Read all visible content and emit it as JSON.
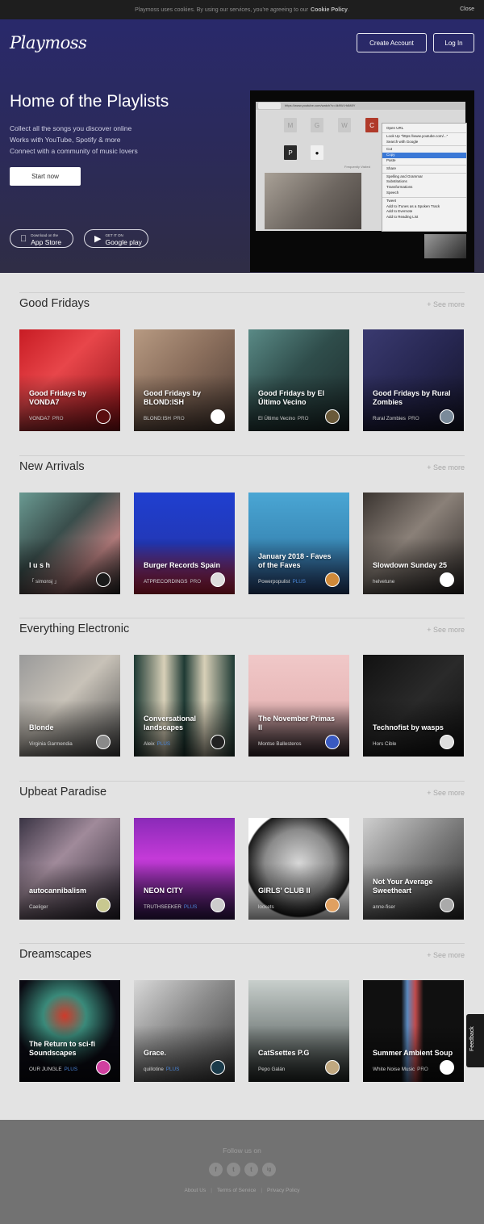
{
  "cookie": {
    "text": "Playmoss uses cookies. By using our services, you're agreeing to our",
    "link": "Cookie Policy",
    "end": ".",
    "close": "Close"
  },
  "header": {
    "logo": "Playmoss",
    "create_account": "Create Account",
    "login": "Log In"
  },
  "hero": {
    "title": "Home of the Playlists",
    "lines": [
      "Collect all the songs you discover online",
      "Works with YouTube, Spotify & more",
      "Connect with a community of music lovers"
    ],
    "start": "Start now",
    "app_store": {
      "small": "Download on the",
      "big": "App Store"
    },
    "google_play": {
      "small": "GET IT ON",
      "big": "Google play"
    }
  },
  "demo": {
    "url": "https://www.youtube.com/watch?v=4k9W-HdM8Y",
    "tiles": [
      "M",
      "G",
      "W",
      "C",
      "P",
      "P"
    ],
    "bottom_label": "Frequently Visited",
    "menu": [
      "Open URL",
      "",
      "Look Up \"https://www.youtube.com/...\"",
      "Search with Google",
      "",
      "Cut",
      "Copy",
      "Paste",
      "",
      "Share",
      "",
      "Spelling and Grammar",
      "Substitutions",
      "Transformations",
      "Speech",
      "",
      "Tweet",
      "Add to iTunes as a Spoken Track",
      "Add to Evernote",
      "Add to Reading List"
    ],
    "highlighted": "Copy"
  },
  "sections": [
    {
      "title": "Good Fridays",
      "see_more": "+ See more",
      "cards": [
        {
          "title": "Good Fridays by VONDA7",
          "owner": "VONDA7",
          "badge": "PRO",
          "badge_type": "pro",
          "bg": "linear-gradient(135deg,#c81c24 0%,#e8464a 40%,#8e1016 100%)",
          "avatar": "#5a0e10"
        },
        {
          "title": "Good Fridays by BLOND:ISH",
          "owner": "BLOND:ISH",
          "badge": "PRO",
          "badge_type": "pro",
          "bg": "linear-gradient(135deg,#b79a82 0%,#8a6e5c 45%,#4c3b33 100%)",
          "avatar": "#ffffff"
        },
        {
          "title": "Good Fridays by El Último Vecino",
          "owner": "El Último Vecino",
          "badge": "PRO",
          "badge_type": "pro",
          "bg": "linear-gradient(135deg,#5a8a86 0%,#2f4d4b 45%,#1c2b2b 100%)",
          "avatar": "#6a5a3a"
        },
        {
          "title": "Good Fridays by Rural Zombies",
          "owner": "Rural Zombies",
          "badge": "PRO",
          "badge_type": "pro",
          "bg": "linear-gradient(135deg,#3a3a70 0%,#262650 50%,#141428 100%)",
          "avatar": "#7a8a9a"
        }
      ]
    },
    {
      "title": "New Arrivals",
      "see_more": "+ See more",
      "cards": [
        {
          "title": "l u s h",
          "owner": "「 simonsj 」",
          "badge": "",
          "badge_type": "",
          "bg": "linear-gradient(135deg,#6a9a92 0%,#3a4e4c 40%,#b07a7a 70%,#2a2a2a 100%)",
          "avatar": "#1a1a1a"
        },
        {
          "title": "Burger Records Spain",
          "owner": "ATPRECORDINGS",
          "badge": "PRO",
          "badge_type": "pro",
          "bg": "linear-gradient(180deg,#1f3fd0 0%,#2238b8 50%,#d0203a 100%)",
          "avatar": "#dddddd"
        },
        {
          "title": "January 2018 - Faves of the Faves",
          "owner": "Powerpopulist",
          "badge": "PLUS",
          "badge_type": "plus",
          "bg": "linear-gradient(180deg,#4aa6d4 0%,#3a8ab8 50%,#2a4a80 100%)",
          "avatar": "#d08a3a"
        },
        {
          "title": "Slowdown Sunday 25",
          "owner": "helvetune",
          "badge": "",
          "badge_type": "",
          "bg": "linear-gradient(135deg,#3a3430 0%,#8a8078 45%,#2a2624 100%)",
          "avatar": "#ffffff"
        }
      ]
    },
    {
      "title": "Everything Electronic",
      "see_more": "+ See more",
      "cards": [
        {
          "title": "Blonde",
          "owner": "Virginia Garmendia",
          "badge": "",
          "badge_type": "",
          "bg": "linear-gradient(135deg,#9a9a9a 0%,#c8c2b8 45%,#4a4a4a 100%)",
          "avatar": "#8a8a8a"
        },
        {
          "title": "Conversational landscapes",
          "owner": "Aleix",
          "badge": "PLUS",
          "badge_type": "plus",
          "bg": "linear-gradient(90deg,#1e3a34 0%,#d8d0b8 30%,#1e3a34 50%,#d8d0b8 70%,#1e3a34 100%)",
          "avatar": "#222222"
        },
        {
          "title": "The November Primas II",
          "owner": "Montse Ballesteros",
          "badge": "",
          "badge_type": "",
          "bg": "linear-gradient(180deg,#f0c8c8 0%,#e8b8b8 50%,#3a2a30 100%)",
          "avatar": "#3a5ac0"
        },
        {
          "title": "Technofist by wasps",
          "owner": "Hors Cible",
          "badge": "",
          "badge_type": "",
          "bg": "linear-gradient(135deg,#111111 0%,#2a2a2a 50%,#101010 100%)",
          "avatar": "#dddddd"
        }
      ]
    },
    {
      "title": "Upbeat Paradise",
      "see_more": "+ See more",
      "cards": [
        {
          "title": "autocannibalism",
          "owner": "Caeliger",
          "badge": "",
          "badge_type": "",
          "bg": "linear-gradient(135deg,#3a3444 0%,#a08a9a 40%,#2a2430 100%)",
          "avatar": "#c8c890"
        },
        {
          "title": "NEON CITY",
          "owner": "TRUTHSEEKER",
          "badge": "PLUS",
          "badge_type": "plus",
          "bg": "linear-gradient(180deg,#8a2ab8 0%,#c43ad8 40%,#3a1a5a 100%)",
          "avatar": "#cccccc"
        },
        {
          "title": "GIRLS' CLUB II",
          "owner": "lockets",
          "badge": "",
          "badge_type": "",
          "bg": "radial-gradient(circle at 50% 45%,#d8d8d8 0%,#8a8a8a 45%,#1a1a1a 70%,#ffffff 72%)",
          "avatar": "#e0a060"
        },
        {
          "title": "Not Your Average Sweetheart",
          "owner": "anne-fiser",
          "badge": "",
          "badge_type": "",
          "bg": "linear-gradient(135deg,#cfcfcf 0%,#7a7a7a 50%,#2a2a2a 100%)",
          "avatar": "#aaaaaa"
        }
      ]
    },
    {
      "title": "Dreamscapes",
      "see_more": "+ See more",
      "cards": [
        {
          "title": "The Return to sci-fi Soundscapes",
          "owner": "OUR JUNGLE",
          "badge": "PLUS",
          "badge_type": "plus",
          "bg": "radial-gradient(circle at 45% 35%,#d03a2a 0%,#3a8a7a 25%,#0a0a12 60%)",
          "avatar": "#d040a0"
        },
        {
          "title": "Grace.",
          "owner": "quillotine",
          "badge": "PLUS",
          "badge_type": "plus",
          "bg": "linear-gradient(135deg,#d8d8d8 0%,#8a8a8a 45%,#3a3a3a 100%)",
          "avatar": "#1a3a4a"
        },
        {
          "title": "CatSsettes P.G",
          "owner": "Pepo Galán",
          "badge": "",
          "badge_type": "",
          "bg": "linear-gradient(180deg,#c8cfcc 0%,#8a9290 45%,#2a302e 100%)",
          "avatar": "#c0a880"
        },
        {
          "title": "Summer Ambient Soup",
          "owner": "White Noise Music",
          "badge": "PRO",
          "badge_type": "pro",
          "bg": "linear-gradient(90deg,#101010 0%,#101010 38%,#5a8ac0 44%,#c04a4a 52%,#101010 60%,#101010 100%)",
          "avatar": "#ffffff"
        }
      ]
    }
  ],
  "feedback": "Feedback",
  "footer": {
    "follow": "Follow us on",
    "social": [
      "f",
      "t",
      "t",
      "ig"
    ],
    "social_names": [
      "facebook-icon",
      "twitter-icon",
      "tumblr-icon",
      "instagram-icon"
    ],
    "links": [
      "About Us",
      "Terms of Service",
      "Privacy Policy"
    ]
  }
}
